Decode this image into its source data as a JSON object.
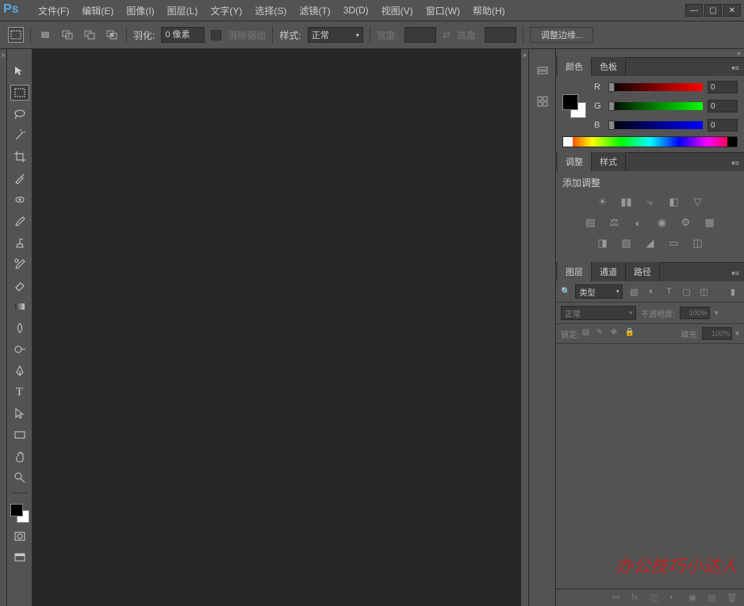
{
  "app": {
    "logo": "Ps"
  },
  "menu": {
    "file": "文件(F)",
    "edit": "编辑(E)",
    "image": "图像(I)",
    "layer": "图层(L)",
    "type": "文字(Y)",
    "select": "选择(S)",
    "filter": "滤镜(T)",
    "threeD": "3D(D)",
    "view": "视图(V)",
    "window": "窗口(W)",
    "help": "帮助(H)"
  },
  "options": {
    "featherLabel": "羽化:",
    "featherValue": "0 像素",
    "antialias": "消除锯齿",
    "styleLabel": "样式:",
    "styleValue": "正常",
    "widthLabel": "宽度:",
    "heightLabel": "高度:",
    "refineEdge": "调整边缘..."
  },
  "colorPanel": {
    "tab1": "颜色",
    "tab2": "色板",
    "rLabel": "R",
    "gLabel": "G",
    "bLabel": "B",
    "rVal": "0",
    "gVal": "0",
    "bVal": "0"
  },
  "adjustPanel": {
    "tab1": "调整",
    "tab2": "样式",
    "title": "添加调整"
  },
  "layersPanel": {
    "tab1": "图层",
    "tab2": "通道",
    "tab3": "路径",
    "kindLabel": "类型",
    "blendMode": "正常",
    "opacityLabel": "不透明度:",
    "opacityVal": "100%",
    "lockLabel": "锁定:",
    "fillLabel": "填充:",
    "fillVal": "100%"
  },
  "watermark": "办公技巧小达人"
}
